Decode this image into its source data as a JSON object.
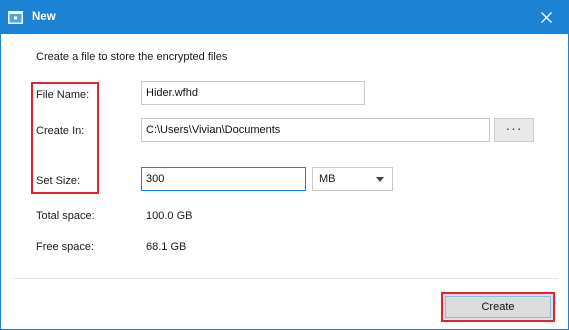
{
  "window": {
    "title": "New",
    "accent": "#1c82d4"
  },
  "description": "Create a file to store the encrypted files",
  "form": {
    "file_name_label": "File Name:",
    "file_name_value": "Hider.wfhd",
    "create_in_label": "Create In:",
    "create_in_value": "C:\\Users\\Vivian\\Documents",
    "browse_label": "···",
    "set_size_label": "Set Size:",
    "set_size_value": "300",
    "unit_selected": "MB"
  },
  "info": {
    "total_label": "Total space:",
    "total_value": "100.0 GB",
    "free_label": "Free space:",
    "free_value": "68.1 GB"
  },
  "actions": {
    "create_label": "Create"
  },
  "icons": {
    "app": "window-lock-icon",
    "close": "close-icon",
    "dropdown": "chevron-down-icon"
  },
  "highlight_color": "#e0242f"
}
